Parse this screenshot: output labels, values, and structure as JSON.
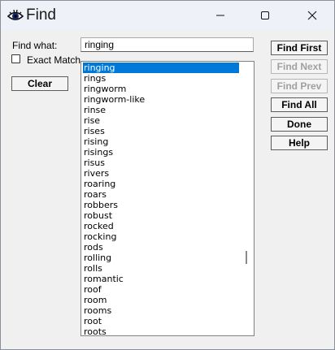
{
  "window": {
    "title": "Find"
  },
  "form": {
    "find_label": "Find what:",
    "find_value": "ringing",
    "exact_match_label": "Exact Match",
    "exact_match_checked": false
  },
  "buttons": {
    "clear": "Clear",
    "find_first": "Find First",
    "find_next": "Find Next",
    "find_prev": "Find Prev",
    "find_all": "Find All",
    "done": "Done",
    "help": "Help"
  },
  "list": {
    "selected": "ringing",
    "items": [
      "ringing",
      "rings",
      "ringworm",
      "ringworm-like",
      "rinse",
      "rise",
      "rises",
      "rising",
      "risings",
      "risus",
      "rivers",
      "roaring",
      "roars",
      "robbers",
      "robust",
      "rocked",
      "rocking",
      "rods",
      "rolling",
      "rolls",
      "romantic",
      "roof",
      "room",
      "rooms",
      "root",
      "roots"
    ]
  },
  "icons": {
    "app": "eye-icon",
    "minimize": "minimize-icon",
    "maximize": "maximize-icon",
    "close": "close-icon"
  },
  "colors": {
    "selection": "#0078d7",
    "disabled_text": "#a0a0a0"
  }
}
